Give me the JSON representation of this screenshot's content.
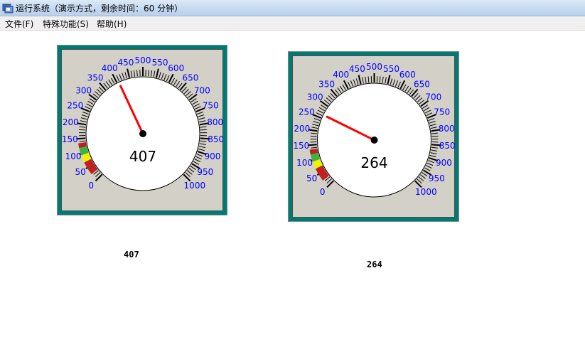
{
  "window": {
    "title": "运行系统（演示方式，剩余时间：60 分钟）"
  },
  "menu": [
    {
      "label": "文件(F)"
    },
    {
      "label": "特殊功能(S)"
    },
    {
      "label": "帮助(H)"
    }
  ],
  "gauges": [
    {
      "value": 407,
      "min": 0,
      "max": 1000,
      "label": "407",
      "readout": "407"
    },
    {
      "value": 264,
      "min": 0,
      "max": 1000,
      "label": "264",
      "readout": "264"
    }
  ],
  "scale_labels": [
    "0",
    "50",
    "100",
    "150",
    "200",
    "250",
    "300",
    "350",
    "400",
    "450",
    "500",
    "550",
    "600",
    "650",
    "700",
    "750",
    "800",
    "850",
    "900",
    "950",
    "1000"
  ],
  "colors": {
    "frame": "#007b74",
    "face": "#d3d0c8",
    "tick_label": "#0000ff",
    "needle": "#ff0000",
    "band_red": "#c0201e",
    "band_yellow": "#f2f200",
    "band_green": "#40b040"
  }
}
